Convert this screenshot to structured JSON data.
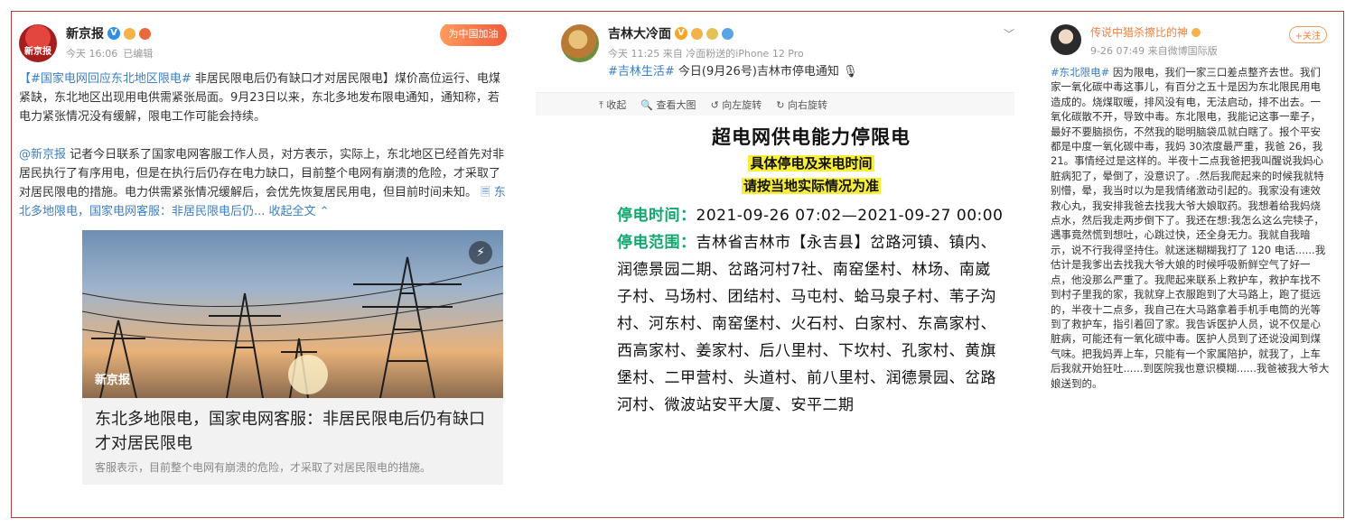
{
  "post1": {
    "name": "新京报",
    "time": "今天 16:06",
    "edited": "已编辑",
    "stamp": "为中国加油",
    "hashtag": "【#国家电网回应东北地区限电#",
    "lead": " 非居民限电后仍有缺口才对居民限电】煤价高位运行、电煤紧缺，东北地区出现用电供需紧张局面。9月23日以来，东北多地发布限电通知，通知称，若电力紧张情况没有缓解，限电工作可能会持续。",
    "mention": "@新京报",
    "para2": " 记者今日联系了国家电网客服工作人员，对方表示，实际上，东北地区已经首先对非居民执行了有序用电，但是在执行后仍存在电力缺口，目前整个电网有崩溃的危险，才采取了对居民限电的措施。电力供需紧张情况缓解后，会优先恢复居民用电，但目前时间未知。",
    "link": " 🗏 东北多地限电，国家电网客服：非居民限电后仍...",
    "collapse": " 收起全文 ⌃",
    "photo_wm": "新京报",
    "card_title": "东北多地限电，国家电网客服：非居民限电后仍有缺口才对居民限电",
    "card_desc": "客服表示，目前整个电网有崩溃的危险，才采取了对居民限电的措施。"
  },
  "post2": {
    "name": "吉林大冷面",
    "time": "今天 11:25 来自 冷面粉送的iPhone 12 Pro",
    "hashtag": "#吉林生活#",
    "text": " 今日(9月26号)吉林市停电通知",
    "toolbar": [
      "⤒ 收起",
      "🔍 查看大图",
      "↺ 向左旋转",
      "↻ 向右旋转"
    ],
    "notice_title": "超电网供电能力停限电",
    "notice_hl1": "具体停电及来电时间",
    "notice_hl2": "请按当地实际情况为准",
    "time_label": "停电时间：",
    "time_value": "2021-09-26 07:02—2021-09-27 00:00",
    "range_label": "停电范围：",
    "range_value": "吉林省吉林市【永吉县】岔路河镇、镇内、润德景园二期、岔路河村7社、南窑堡村、林场、南崴子村、马场村、团结村、马屯村、蛤马泉子村、苇子沟村、河东村、南窑堡村、火石村、白家村、东高家村、西高家村、姜家村、后八里村、下坎村、孔家村、黄旗堡村、二甲营村、头道村、前八里村、润德景园、岔路河村、微波站安平大厦、安平二期"
  },
  "post3": {
    "name": "传说中猎杀擦比的神",
    "time": "9-26 07:49 来自微博国际版",
    "follow": "+关注",
    "hashtag": "#东北限电#",
    "text": " 因为限电，我们一家三口差点整齐去世。我们家一氧化碳中毒这事儿，有百分之五十是因为东北限民用电造成的。烧煤取暖，排风没有电，无法启动，排不出去。一氧化碳散不开，导致中毒。东北限电，我能记这事一辈子，最好不要脑损伤，不然我的聪明脑袋瓜就白瞎了。报个平安都是中度一氧化碳中毒，我妈 30浓度最严重，我爸 26，我 21。事情经过是这样的。半夜十二点我爸把我叫醒说我妈心脏病犯了，晕倒了，没意识了。.然后我爬起来的时候我就特别懵，晕，我当时以为是我情绪激动引起的。我家没有速效救心丸，我安排我爸去找我大爷大娘取药。我想着给我妈烧点水，然后我走两步倒下了。我还在想:我怎么这么完犊子，遇事竟然慌到想吐，心跳过快，还全身无力。我就自我暗示，说不行我得坚持住。就迷迷糊糊我打了 120 电话......我估计是我爹出去找我大爷大娘的时候呼吸新鲜空气了好一点，他没那么严重了。我爬起来联系上救护车，救护车找不到村子里我的家，我就穿上衣服跑到了大马路上，跑了挺远的，半夜十二点多，我自己在大马路拿着手机手电筒的光等到了救护车，指引着回了家。我告诉医护人员，说不仅是心脏病，可能还有一氧化碳中毒。医护人员到了还说没闻到煤气味。把我妈弄上车，只能有一个家属陪护，就我了，上车后我就开始狂吐......到医院我也意识模糊......我爸被我大爷大娘送到的。"
  }
}
